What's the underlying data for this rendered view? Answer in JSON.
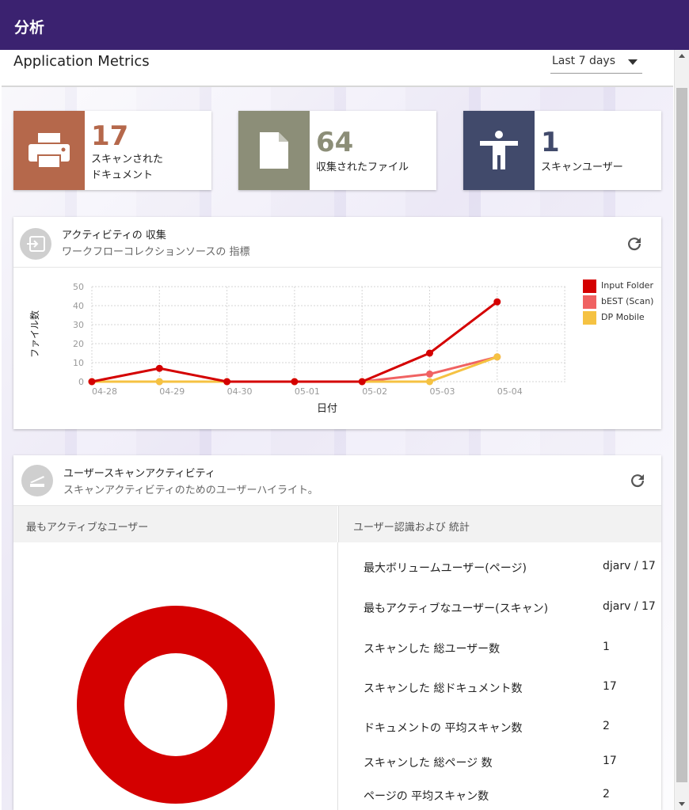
{
  "topbar": {
    "title": "分析"
  },
  "header": {
    "app_title": "Application Metrics",
    "range": "Last 7 days"
  },
  "stats": [
    {
      "value": "17",
      "label_line1": "スキャンされた",
      "label_line2": "ドキュメント",
      "color": "#b5684b",
      "num_color": "#b5684b",
      "icon": "printer-icon"
    },
    {
      "value": "64",
      "label_line1": "収集されたファイル",
      "label_line2": "",
      "color": "#8c8e78",
      "num_color": "#8c8e78",
      "icon": "document-icon"
    },
    {
      "value": "1",
      "label_line1": "スキャンユーザー",
      "label_line2": "",
      "color": "#414a6b",
      "num_color": "#414a6b",
      "icon": "person-icon"
    }
  ],
  "activity_card": {
    "title": "アクティビティの 収集",
    "subtitle": "ワークフローコレクションソースの 指標"
  },
  "chart_data": {
    "type": "line",
    "x": [
      "04-28",
      "04-29",
      "04-30",
      "05-01",
      "05-02",
      "05-03",
      "05-04"
    ],
    "xlabel": "日付",
    "ylabel": "ファイル数",
    "ylim": [
      0,
      50
    ],
    "yticks": [
      "50",
      "40",
      "30",
      "20",
      "10",
      "0"
    ],
    "grid": true,
    "legend_position": "right",
    "series": [
      {
        "name": "Input Folder",
        "color": "#d40000",
        "values": [
          0,
          7,
          0,
          0,
          0,
          15,
          42
        ]
      },
      {
        "name": "bEST (Scan)",
        "color": "#f06262",
        "values": [
          0,
          0,
          0,
          0,
          0,
          4,
          13
        ]
      },
      {
        "name": "DP Mobile",
        "color": "#f5c242",
        "values": [
          0,
          0,
          0,
          0,
          0,
          0,
          13
        ]
      }
    ]
  },
  "user_card": {
    "title": "ユーザースキャンアクティビティ",
    "subtitle": "スキャンアクティビティのためのユーザーハイライト。",
    "left_header": "最もアクティブなユーザー",
    "right_header": "ユーザー認識および 統計",
    "donut_color": "#d40000",
    "rows": [
      {
        "key": "最大ボリュームユーザー(ページ)",
        "value": "djarv / 17"
      },
      {
        "key": "最もアクティブなユーザー(スキャン)",
        "value": "djarv / 17"
      },
      {
        "key": "スキャンした 総ユーザー数",
        "value": "1"
      },
      {
        "key": "スキャンした 総ドキュメント数",
        "value": "17"
      },
      {
        "key": "ドキュメントの 平均スキャン数",
        "value": "2"
      },
      {
        "key": "スキャンした 総ページ 数",
        "value": "17"
      },
      {
        "key": "ページの 平均スキャン数",
        "value": "2"
      }
    ]
  }
}
